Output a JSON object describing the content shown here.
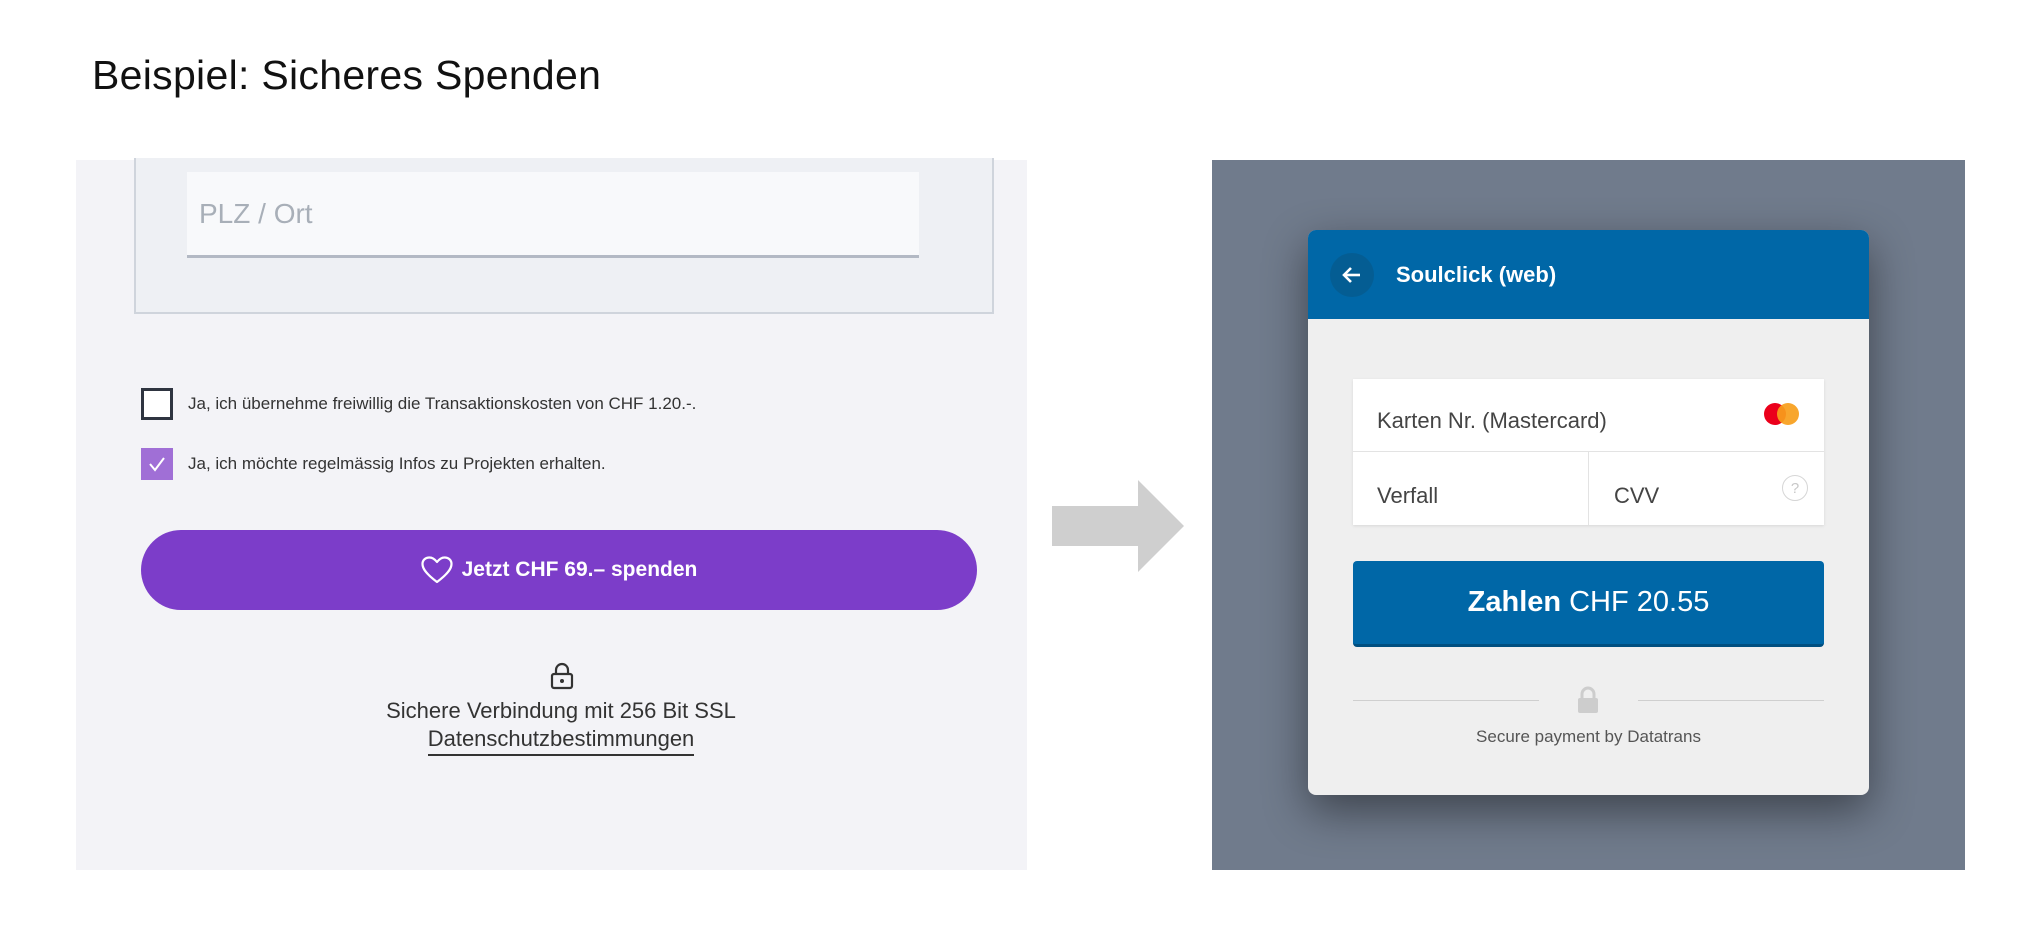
{
  "page": {
    "title": "Beispiel: Sicheres Spenden"
  },
  "left_form": {
    "plz_placeholder": "PLZ / Ort",
    "checkboxes": [
      {
        "label": "Ja, ich übernehme freiwillig die Transaktionskosten von CHF 1.20.-.",
        "checked": false
      },
      {
        "label": "Ja, ich möchte regelmässig Infos zu Projekten erhalten.",
        "checked": true
      }
    ],
    "donate_button": "Jetzt CHF 69.– spenden",
    "ssl_text": "Sichere Verbindung mit 256 Bit SSL",
    "privacy_link": "Datenschutzbestimmungen",
    "colors": {
      "accent": "#7c3dc9",
      "checkbox_checked": "#a06fd6",
      "panel_bg": "#f3f3f7"
    }
  },
  "arrow_icon": "arrow-right-icon",
  "payment_modal": {
    "title": "Soulclick (web)",
    "card_number_label": "Karten Nr. (Mastercard)",
    "card_brand_icon": "mastercard-icon",
    "expiry_label": "Verfall",
    "cvv_label": "CVV",
    "help_icon_glyph": "?",
    "pay_button": {
      "bold": "Zahlen",
      "amount": "CHF 20.55"
    },
    "secure_text": "Secure payment by Datatrans",
    "colors": {
      "header": "#0067a7",
      "backdrop": "#707b8c",
      "modal_bg": "#efefef"
    }
  }
}
